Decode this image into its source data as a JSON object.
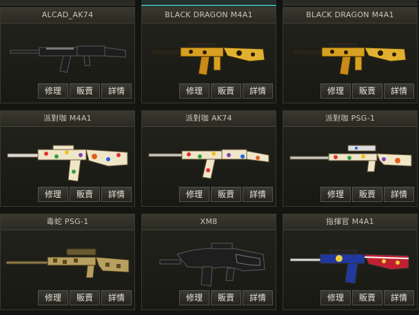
{
  "buttons": {
    "repair": "修理",
    "sell": "販賣",
    "details": "詳情"
  },
  "items": [
    {
      "name": "ALCAD_AK74",
      "gun_icon": "ak74-rifle-icon"
    },
    {
      "name": "BLACK DRAGON M4A1",
      "gun_icon": "m4a1-gold-dragon-icon"
    },
    {
      "name": "BLACK DRAGON M4A1",
      "gun_icon": "m4a1-gold-dragon-icon"
    },
    {
      "name": "派對咖 M4A1",
      "gun_icon": "m4a1-party-icon"
    },
    {
      "name": "派對咖 AK74",
      "gun_icon": "ak74-party-icon"
    },
    {
      "name": "派對咖 PSG-1",
      "gun_icon": "psg1-party-icon"
    },
    {
      "name": "毒蛇 PSG-1",
      "gun_icon": "psg1-snake-icon"
    },
    {
      "name": "XM8",
      "gun_icon": "xm8-rifle-icon"
    },
    {
      "name": "指揮官 M4A1",
      "gun_icon": "m4a1-commander-icon"
    }
  ],
  "colors": {
    "accent_tab": "#3fa7a0",
    "text": "#c8c6b8"
  }
}
